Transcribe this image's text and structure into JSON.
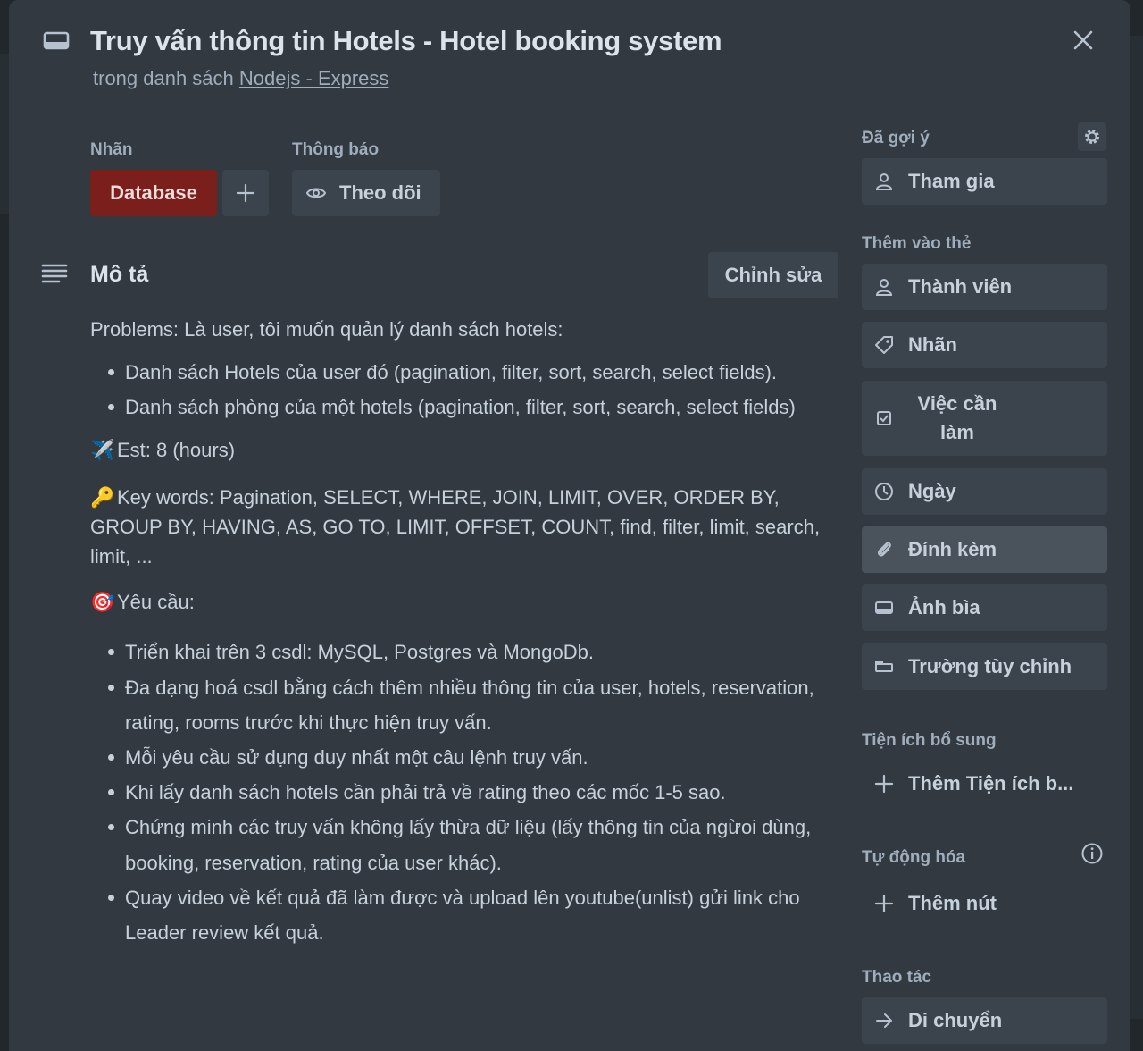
{
  "card": {
    "title": "Truy vấn thông tin Hotels - Hotel booking system",
    "list_prefix": "trong danh sách",
    "list_name": "Nodejs - Express"
  },
  "labels": {
    "heading": "Nhãn",
    "items": [
      "Database"
    ],
    "chip_color": "#7a1f1c"
  },
  "notifications": {
    "heading": "Thông báo",
    "watch_label": "Theo dõi"
  },
  "description": {
    "heading": "Mô tả",
    "edit_label": "Chỉnh sửa",
    "problems": "Problems: Là user, tôi muốn quản lý danh sách hotels:",
    "problem_items": [
      "Danh sách Hotels của user đó (pagination, filter, sort, search, select fields).",
      "Danh sách phòng của một hotels (pagination, filter, sort, search, select fields)"
    ],
    "est_icon": "✈️",
    "est": "Est: 8 (hours)",
    "keywords_icon": "🔑",
    "keywords": "Key words: Pagination, SELECT, WHERE, JOIN, LIMIT, OVER, ORDER BY, GROUP BY, HAVING, AS, GO TO, LIMIT, OFFSET, COUNT, find, filter, limit, search, limit, ...",
    "requirements_icon": "🎯",
    "requirements": "Yêu cầu:",
    "requirement_items": [
      "Triển khai trên 3 csdl: MySQL, Postgres và MongoDb.",
      "Đa dạng hoá csdl bằng cách thêm nhiều thông tin của user, hotels, reservation, rating, rooms trước khi thực hiện truy vấn.",
      "Mỗi yêu cầu sử dụng duy nhất một câu lệnh truy vấn.",
      "Khi lấy danh sách hotels cần phải trả về rating theo các mốc 1-5 sao.",
      "Chứng minh các truy vấn không lấy thừa dữ liệu (lấy thông tin của ngừoi dùng, booking, reservation, rating của user khác).",
      "Quay video về kết quả đã làm được và upload lên youtube(unlist) gửi link cho Leader review kết quả."
    ]
  },
  "sidebar": {
    "suggested": "Đã gợi ý",
    "join": "Tham gia",
    "add_to_card": "Thêm vào thẻ",
    "members": "Thành viên",
    "labels": "Nhãn",
    "checklist": "Việc cần làm",
    "dates": "Ngày",
    "attachment": "Đính kèm",
    "cover": "Ảnh bìa",
    "custom_fields": "Trường tùy chỉnh",
    "powerups": "Tiện ích bổ sung",
    "add_powerup": "Thêm Tiện ích b...",
    "automation": "Tự động hóa",
    "add_button": "Thêm nút",
    "actions": "Thao tác",
    "move": "Di chuyển"
  }
}
